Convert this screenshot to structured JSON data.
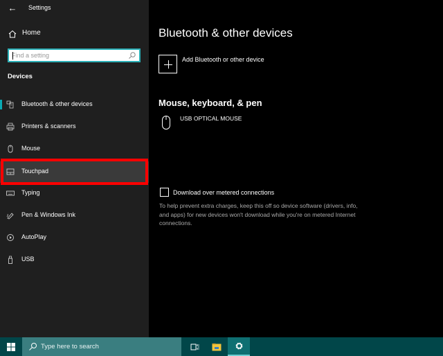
{
  "window": {
    "app_title": "Settings",
    "back_icon": "back-arrow-icon"
  },
  "sidebar": {
    "home_label": "Home",
    "search_placeholder": "Find a setting",
    "section_title": "Devices",
    "items": [
      {
        "label": "Bluetooth & other devices",
        "icon": "bluetooth-devices-icon",
        "active": true
      },
      {
        "label": "Printers & scanners",
        "icon": "printer-icon",
        "active": false
      },
      {
        "label": "Mouse",
        "icon": "mouse-icon",
        "active": false
      },
      {
        "label": "Touchpad",
        "icon": "touchpad-icon",
        "active": false,
        "highlighted": true
      },
      {
        "label": "Typing",
        "icon": "keyboard-icon",
        "active": false
      },
      {
        "label": "Pen & Windows Ink",
        "icon": "pen-icon",
        "active": false
      },
      {
        "label": "AutoPlay",
        "icon": "autoplay-icon",
        "active": false
      },
      {
        "label": "USB",
        "icon": "usb-icon",
        "active": false
      }
    ]
  },
  "main": {
    "page_title": "Bluetooth & other devices",
    "add_device_label": "Add Bluetooth or other device",
    "section_heading": "Mouse, keyboard, & pen",
    "devices": [
      {
        "name": "USB OPTICAL MOUSE",
        "icon": "mouse-icon"
      }
    ],
    "metered": {
      "label": "Download over metered connections",
      "checked": false,
      "help_text": "To help prevent extra charges, keep this off so device software (drivers, info, and apps) for new devices won't download while you're on metered Internet connections."
    }
  },
  "taskbar": {
    "search_placeholder": "Type here to search",
    "buttons": [
      {
        "name": "task-view",
        "icon": "task-view-icon"
      },
      {
        "name": "file-explorer",
        "icon": "folder-icon"
      },
      {
        "name": "settings",
        "icon": "gear-icon",
        "active": true
      }
    ]
  },
  "colors": {
    "accent": "#0aa9b3",
    "highlight_border": "#ff0000",
    "taskbar": "#014649",
    "taskbar_search": "#3a7e80"
  }
}
